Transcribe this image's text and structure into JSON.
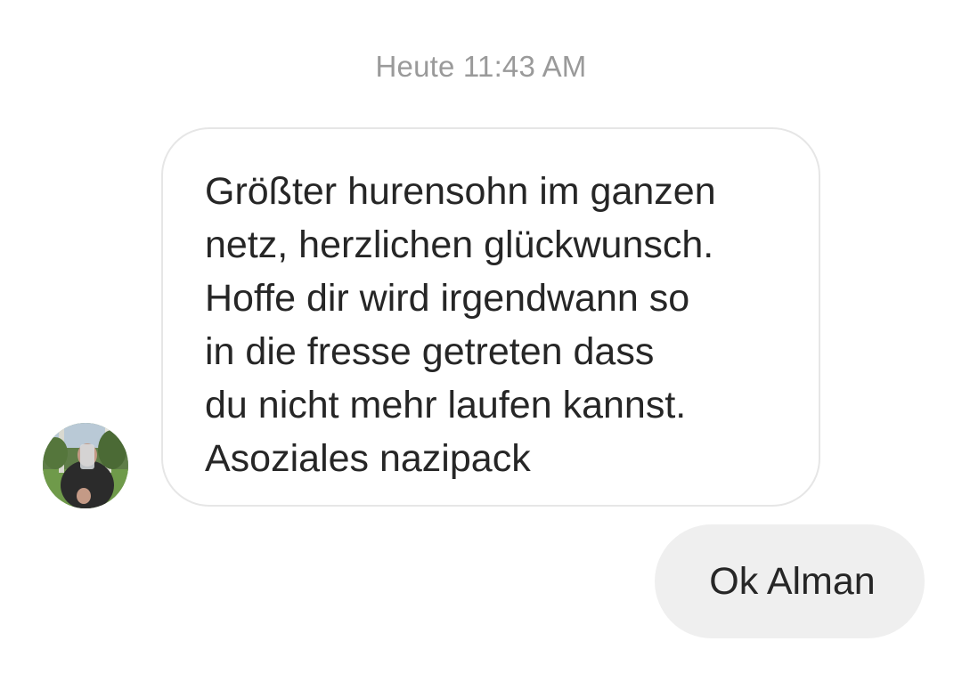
{
  "chat": {
    "timestamp": "Heute 11:43 AM",
    "messages": [
      {
        "direction": "incoming",
        "text": "Größter hurensohn im ganzen\nnetz, herzlichen glückwunsch.\nHoffe dir wird irgendwann so\nin die fresse getreten dass\ndu nicht mehr laufen kannst.\nAsoziales nazipack"
      },
      {
        "direction": "outgoing",
        "text": "Ok Alman"
      }
    ]
  }
}
